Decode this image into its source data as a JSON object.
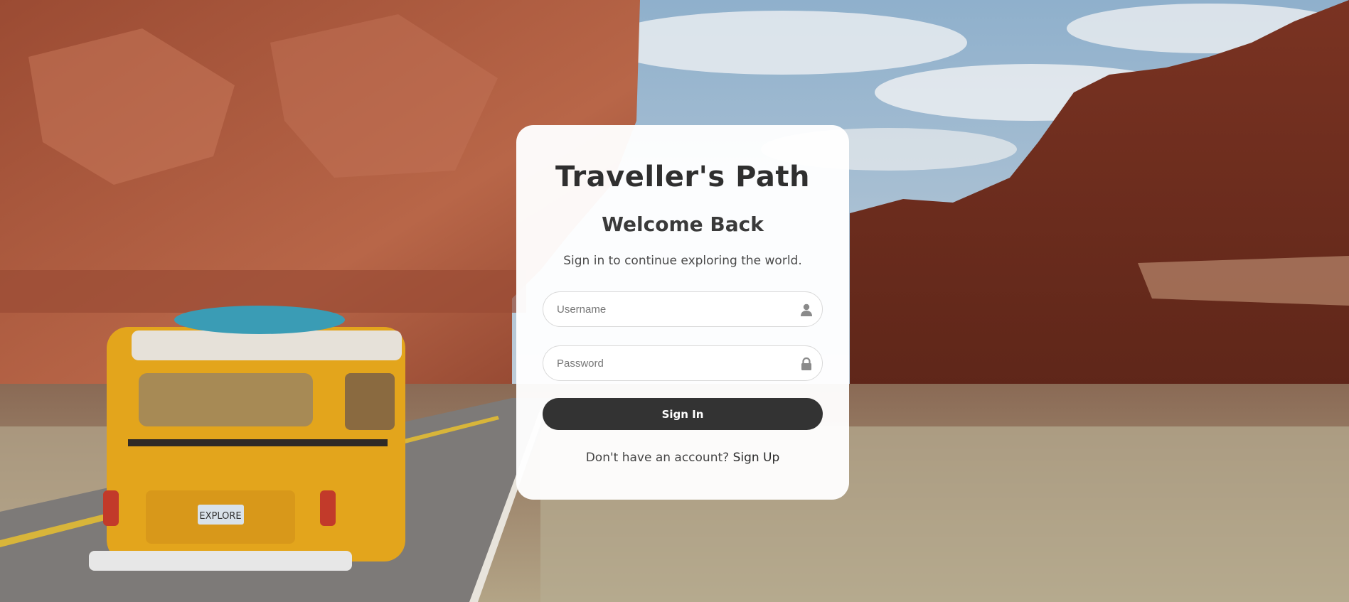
{
  "background": {
    "sky_color": "#b9c8d6",
    "rock_color": "#a5543a",
    "road_color": "#7d7a78",
    "van_color": "#e3a51c",
    "van_plate": "EXPLORE"
  },
  "login": {
    "brand": "Traveller's Path",
    "heading": "Welcome Back",
    "subtitle": "Sign in to continue exploring the world.",
    "username_placeholder": "Username",
    "password_placeholder": "Password",
    "submit_label": "Sign In",
    "footer_text": "Don't have an account?",
    "signup_link": "Sign Up"
  },
  "icons": {
    "username": "user-icon",
    "password": "lock-icon"
  },
  "colors": {
    "button": "#333333",
    "card": "#ffffff"
  }
}
